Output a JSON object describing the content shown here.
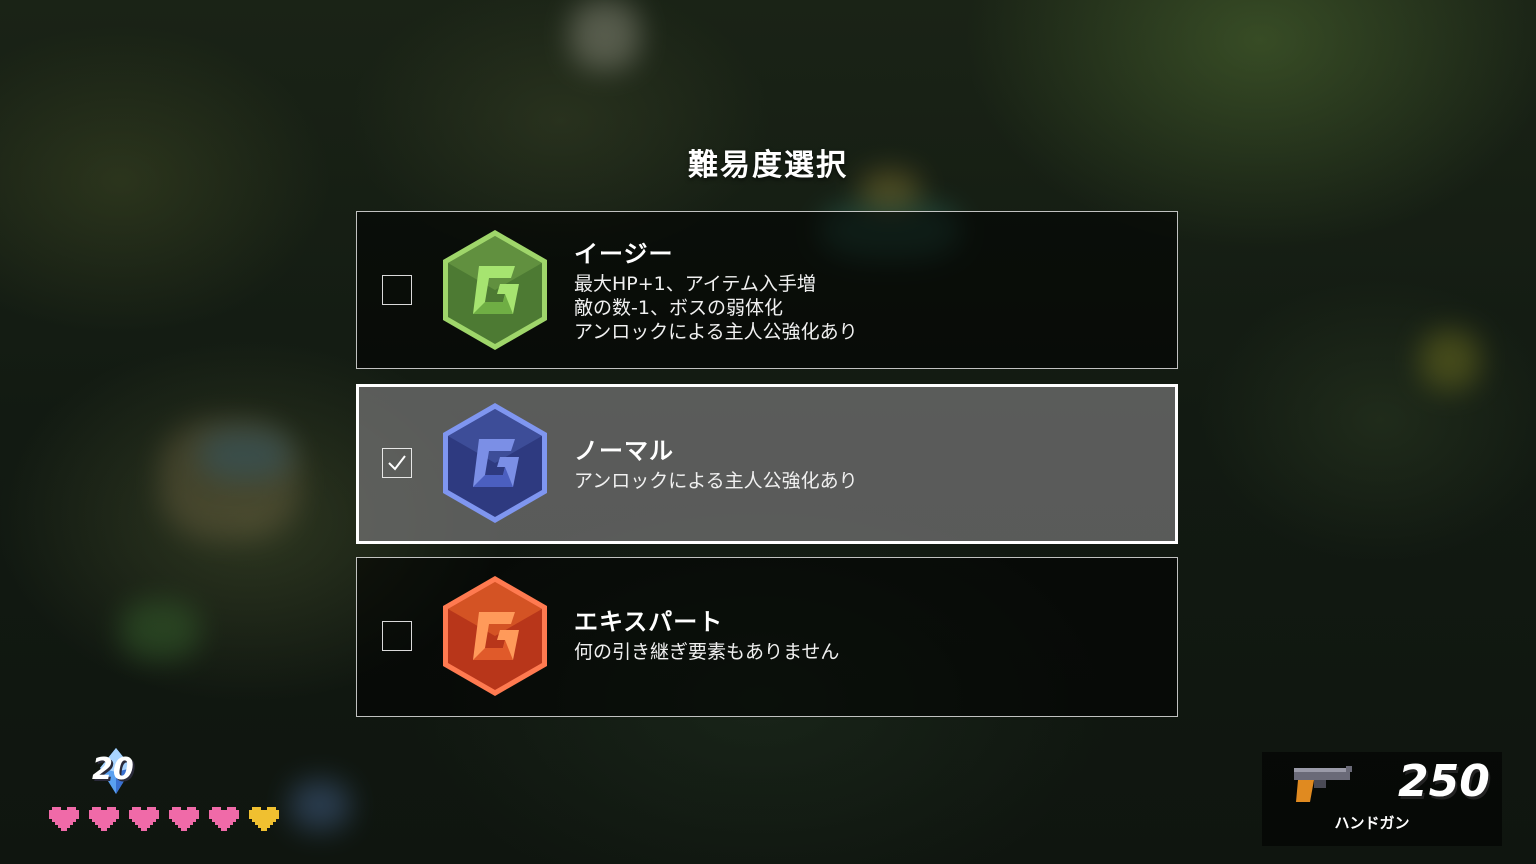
{
  "screen": {
    "title": "難易度選択"
  },
  "difficulties": [
    {
      "name": "イージー",
      "desc": [
        "最大HP+1、アイテム入手増",
        "敵の数-1、ボスの弱体化",
        "アンロックによる主人公強化あり"
      ],
      "checked": false,
      "badge_color": "#5a8a3a",
      "badge_edge": "#a8e070",
      "icon": "g-emblem-green-icon"
    },
    {
      "name": "ノーマル",
      "desc": [
        "アンロックによる主人公強化あり"
      ],
      "checked": true,
      "badge_color": "#3a4a9a",
      "badge_edge": "#7f96f0",
      "icon": "g-emblem-blue-icon"
    },
    {
      "name": "エキスパート",
      "desc": [
        "何の引き継ぎ要素もありません"
      ],
      "checked": false,
      "badge_color": "#c8401a",
      "badge_edge": "#ff7a50",
      "icon": "g-emblem-orange-icon"
    }
  ],
  "hud": {
    "gems": "20",
    "gem_icon": "crystal-icon",
    "hearts_pink": 5,
    "hearts_gold": 1,
    "ammo": "250",
    "weapon_name": "ハンドガン",
    "weapon_icon": "handgun-icon"
  }
}
